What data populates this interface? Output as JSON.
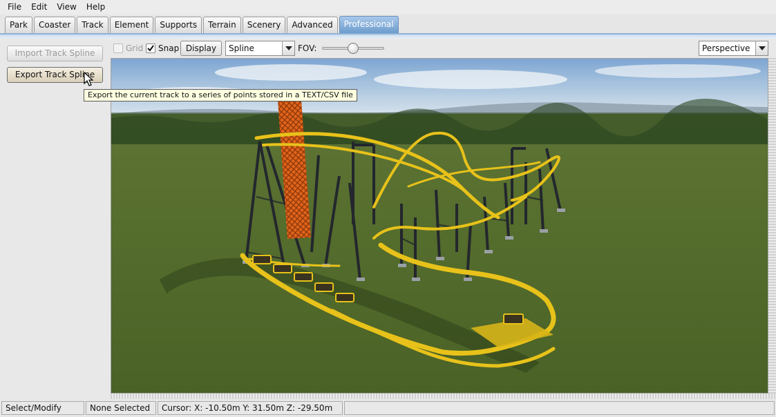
{
  "menu": [
    "File",
    "Edit",
    "View",
    "Help"
  ],
  "tabs": [
    {
      "label": "Park",
      "active": false
    },
    {
      "label": "Coaster",
      "active": false
    },
    {
      "label": "Track",
      "active": false
    },
    {
      "label": "Element",
      "active": false
    },
    {
      "label": "Supports",
      "active": false
    },
    {
      "label": "Terrain",
      "active": false
    },
    {
      "label": "Scenery",
      "active": false
    },
    {
      "label": "Advanced",
      "active": false
    },
    {
      "label": "Professional",
      "active": true
    }
  ],
  "left_panel": {
    "import_label": "Import Track Spline",
    "export_label": "Export Track Spline"
  },
  "tooltip": "Export the current track to a series of points stored in a TEXT/CSV file",
  "toolbar": {
    "grid_label": "Grid",
    "grid_checked": false,
    "snap_label": "Snap",
    "snap_checked": true,
    "display_label": "Display",
    "display_mode": "Spline",
    "fov_label": "FOV:",
    "fov_value": 0.5,
    "projection": "Perspective"
  },
  "status": {
    "mode": "Select/Modify",
    "selection": "None Selected",
    "cursor": "Cursor: X:  -10.50m Y:  31.50m  Z:  -29.50m"
  },
  "colors": {
    "track": "#e8c21a",
    "supports": "#23272d",
    "lift_tower": "#e0641c",
    "grass": "#4f6a2a",
    "sky_top": "#7ea6d2",
    "tab_active": "#7fa8d6"
  }
}
